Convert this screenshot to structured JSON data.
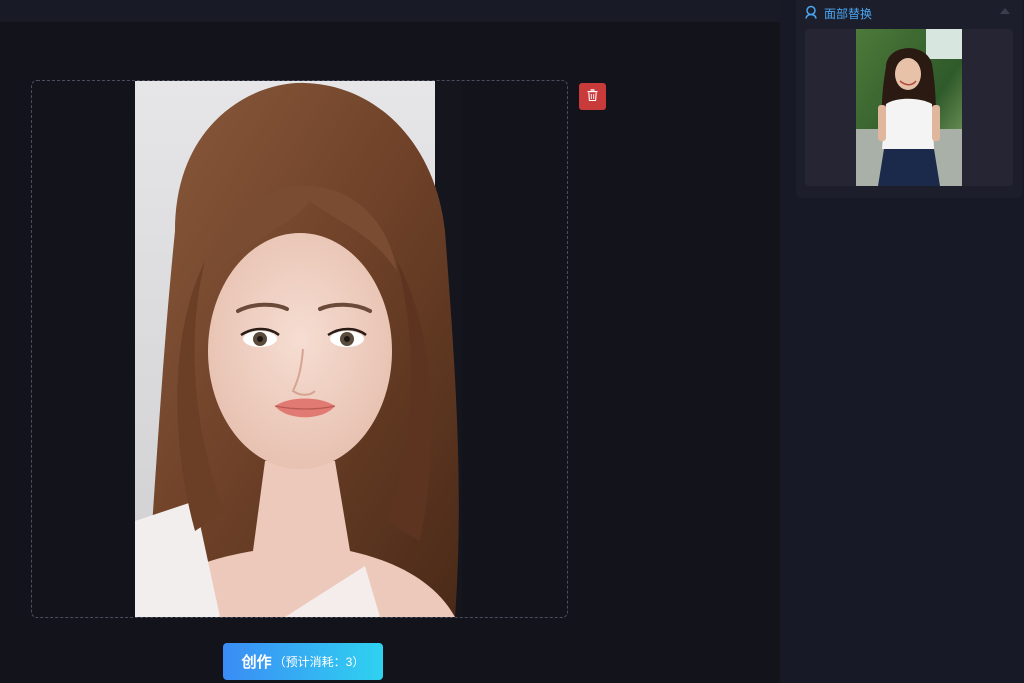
{
  "workspace": {
    "main_image_alt": "portrait of a young woman with long brown hair",
    "delete_icon": "trash-icon"
  },
  "action": {
    "create_label": "创作",
    "cost_note": "（预计消耗：3）"
  },
  "sidebar": {
    "face_swap": {
      "icon": "face-outline-icon",
      "title": "面部替换",
      "collapse_icon": "caret-up-icon",
      "thumbnail_alt": "smiling woman in white top outdoors"
    }
  },
  "colors": {
    "accent": "#4aa6f2",
    "danger": "#c93a3a",
    "button_gradient_start": "#3b8cf5",
    "button_gradient_end": "#2fd2f0",
    "background": "#13131c"
  }
}
